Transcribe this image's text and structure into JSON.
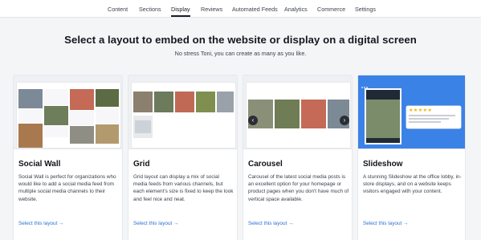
{
  "nav": {
    "tabs": [
      {
        "label": "Content",
        "active": false
      },
      {
        "label": "Sections",
        "active": false
      },
      {
        "label": "Display",
        "active": true
      },
      {
        "label": "Reviews",
        "active": false
      },
      {
        "label": "Automated Feeds",
        "active": false
      },
      {
        "label": "Analytics",
        "active": false
      },
      {
        "label": "Commerce",
        "active": false
      },
      {
        "label": "Settings",
        "active": false
      }
    ]
  },
  "header": {
    "title": "Select a layout to embed on the website or display on a digital screen",
    "subtitle": "No stress Toni, you can create as many as you like."
  },
  "cards": [
    {
      "title": "Social Wall",
      "description": "Social Wall is perfect for organizations who would like to add a social media feed from multiple social media channels to their website.",
      "cta": "Select this layout →"
    },
    {
      "title": "Grid",
      "description": "Grid layout can display a mix of social media feeds from various channels, but each element's size is fixed to keep the look and feel nice and neat.",
      "cta": "Select this layout →"
    },
    {
      "title": "Carousel",
      "description": "Carousel of the latest social media posts is an excellent option for your homepage or product pages when you don't have much of vertical space available.",
      "cta": "Select this layout →"
    },
    {
      "title": "Slideshow",
      "description": "A stunning Slideshow at the office lobby, in-store displays, and on a website keeps visitors engaged with your content.",
      "cta": "Select this layout →"
    }
  ],
  "icons": {
    "carousel_prev": "chevron-left-icon",
    "carousel_next": "chevron-right-icon",
    "rating": "star-icon"
  },
  "colors": {
    "accent_link": "#2b6fd6",
    "slideshow_bg": "#3b82e6",
    "active_tab_underline": "#1a1d24"
  }
}
